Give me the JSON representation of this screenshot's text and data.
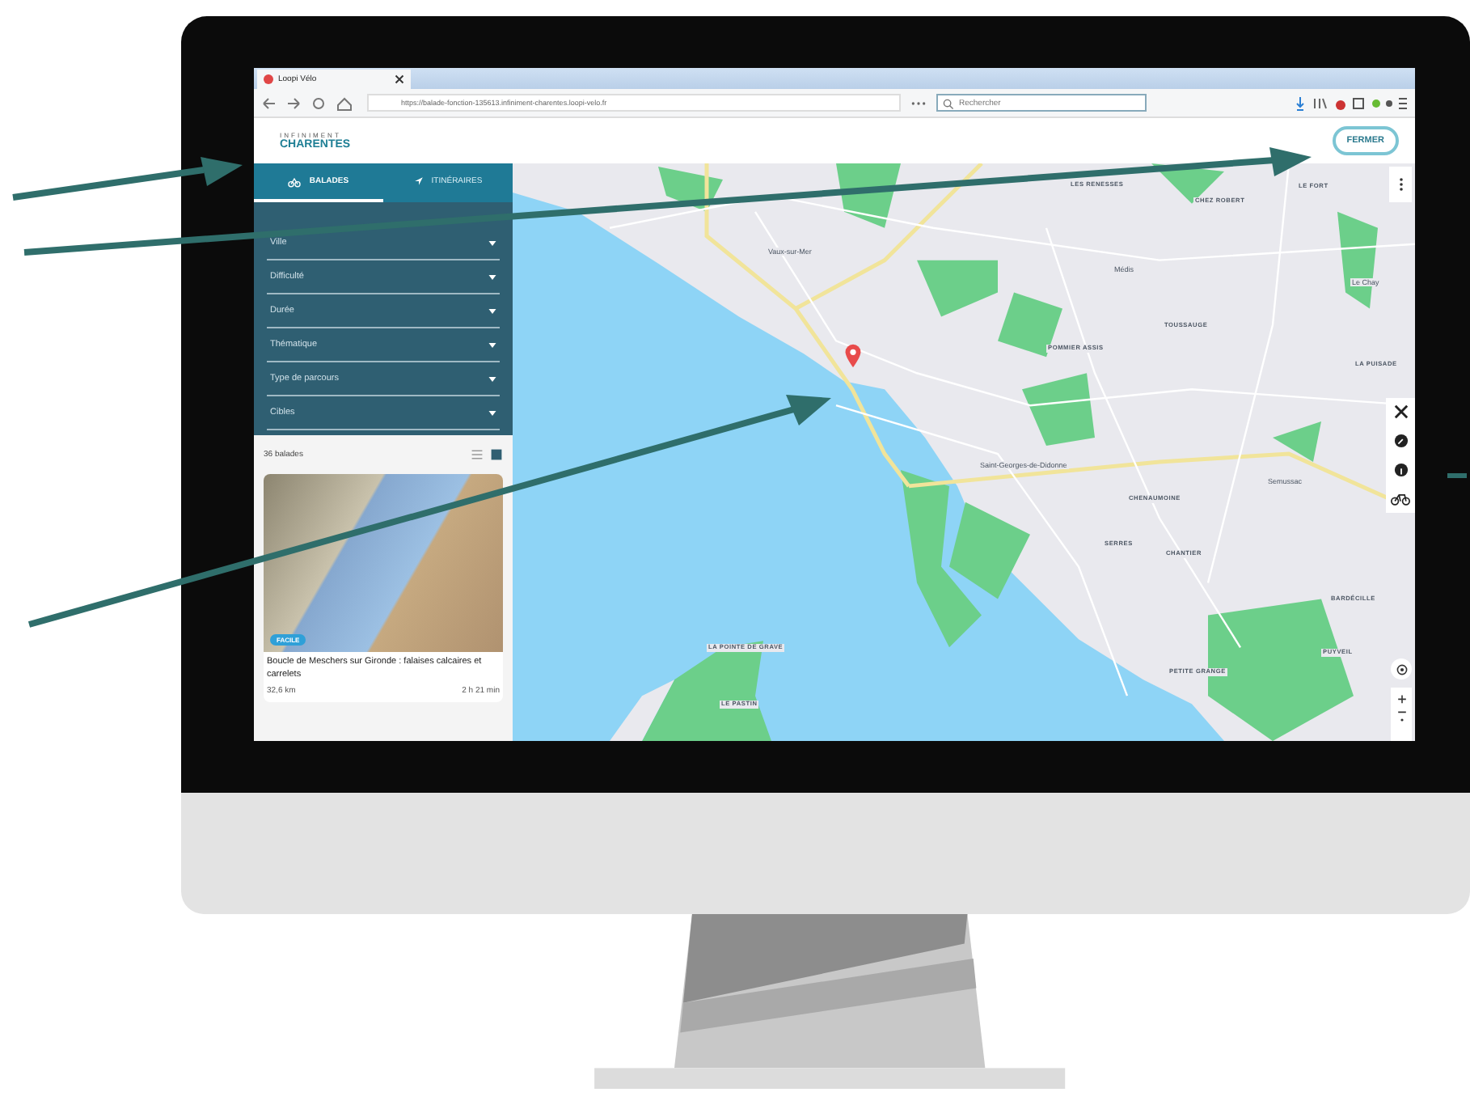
{
  "browser": {
    "tab_title": "Loopi Vélo",
    "url": "https://balade-fonction-135613.infiniment-charentes.loopi-velo.fr",
    "search": {
      "placeholder": "Rechercher"
    }
  },
  "header": {
    "logo_top": "INFINIMENT",
    "logo_bottom": "CHARENTES",
    "close_button": "FERMER"
  },
  "tabs": [
    {
      "label": "BALADES",
      "selected": true
    },
    {
      "label": "ITINÉRAIRES",
      "selected": false
    }
  ],
  "filters": [
    "Ville",
    "Difficulté",
    "Durée",
    "Thématique",
    "Type de parcours",
    "Cibles"
  ],
  "results": {
    "count": "36 balades",
    "view_modes": [
      {
        "kind": "list",
        "selected": false
      },
      {
        "kind": "grid",
        "selected": true
      }
    ]
  },
  "cards": [
    {
      "badge": "FACILE",
      "title": "Boucle de Meschers sur Gironde : falaises calcaires et carrelets",
      "distance": "32,6 km",
      "duration": "2 h 21 min"
    }
  ],
  "map": {
    "labels": [
      {
        "text": "LES RENESSES",
        "kind": "place"
      },
      {
        "text": "CHEZ ROBERT",
        "kind": "place"
      },
      {
        "text": "LE FORT",
        "kind": "place"
      },
      {
        "text": "Vaux-sur-Mer",
        "kind": "town"
      },
      {
        "text": "Médis",
        "kind": "town"
      },
      {
        "text": "TOUSSAUGE",
        "kind": "place"
      },
      {
        "text": "POMMIER ASSIS",
        "kind": "place"
      },
      {
        "text": "Le Chay",
        "kind": "town"
      },
      {
        "text": "LA PUISADE",
        "kind": "place"
      },
      {
        "text": "Saint-Georges-de-Didonne",
        "kind": "town"
      },
      {
        "text": "Semussac",
        "kind": "town"
      },
      {
        "text": "CHENAUMOINE",
        "kind": "place"
      },
      {
        "text": "SERRES",
        "kind": "place"
      },
      {
        "text": "CHANTIER",
        "kind": "place"
      },
      {
        "text": "BARDÉCILLE",
        "kind": "place"
      },
      {
        "text": "PUYVEIL",
        "kind": "place"
      },
      {
        "text": "PETITE GRANGE",
        "kind": "place"
      },
      {
        "text": "LA POINTE DE GRAVE",
        "kind": "place"
      },
      {
        "text": "LE PASTIN",
        "kind": "place"
      }
    ]
  }
}
